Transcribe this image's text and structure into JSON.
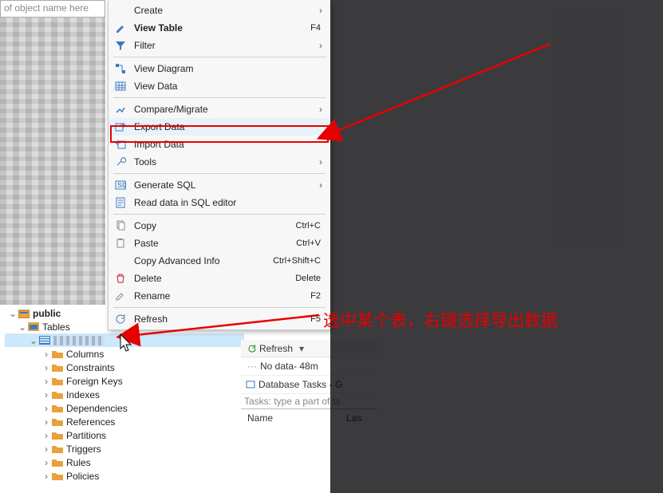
{
  "search": {
    "placeholder": "of object name here"
  },
  "contextMenu": {
    "items": {
      "create": {
        "label": "Create"
      },
      "viewTable": {
        "label": "View Table",
        "shortcut": "F4"
      },
      "filter": {
        "label": "Filter"
      },
      "viewDiagram": {
        "label": "View Diagram"
      },
      "viewData": {
        "label": "View Data"
      },
      "compare": {
        "label": "Compare/Migrate"
      },
      "exportData": {
        "label": "Export Data"
      },
      "importData": {
        "label": "Import Data"
      },
      "tools": {
        "label": "Tools"
      },
      "generateSql": {
        "label": "Generate SQL"
      },
      "readSql": {
        "label": "Read data in SQL editor"
      },
      "copy": {
        "label": "Copy",
        "shortcut": "Ctrl+C"
      },
      "paste": {
        "label": "Paste",
        "shortcut": "Ctrl+V"
      },
      "copyAdv": {
        "label": "Copy Advanced Info",
        "shortcut": "Ctrl+Shift+C"
      },
      "delete": {
        "label": "Delete",
        "shortcut": "Delete"
      },
      "rename": {
        "label": "Rename",
        "shortcut": "F2"
      },
      "refresh": {
        "label": "Refresh",
        "shortcut": "F5"
      }
    }
  },
  "tree": {
    "public": "public",
    "tables": "Tables",
    "children": {
      "columns": "Columns",
      "constraints": "Constraints",
      "foreignKeys": "Foreign Keys",
      "indexes": "Indexes",
      "dependencies": "Dependencies",
      "references": "References",
      "partitions": "Partitions",
      "triggers": "Triggers",
      "rules": "Rules",
      "policies": "Policies"
    }
  },
  "rightPanel": {
    "refresh": "Refresh",
    "nodata": "No data- 48m",
    "dbtasks": "Database Tasks - G",
    "tasksPh": "Tasks: type a part of ta",
    "colName": "Name",
    "colLast": "Las"
  },
  "annotation": "选中某个表，右键选择导出数据"
}
